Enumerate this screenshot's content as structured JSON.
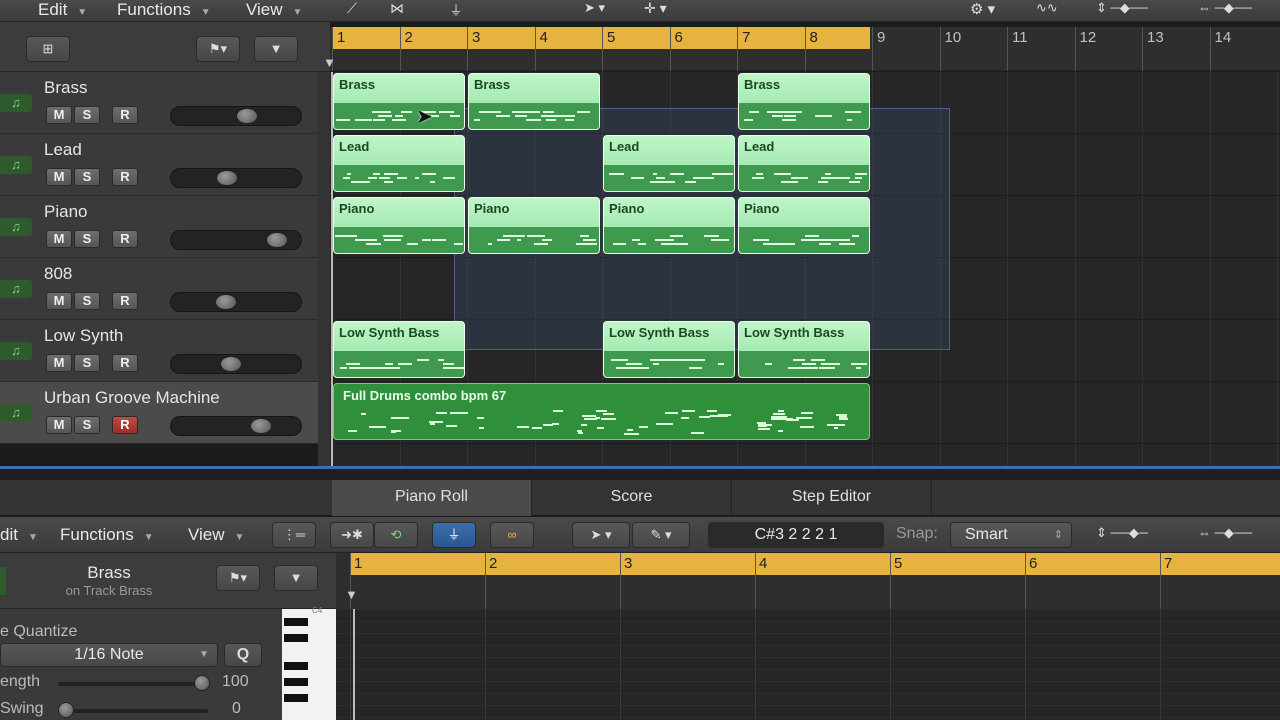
{
  "toolbar": {
    "edit": "Edit",
    "functions": "Functions",
    "view": "View"
  },
  "tracks": [
    {
      "name": "Brass",
      "m": "M",
      "s": "S",
      "r": "R",
      "volume": 0.6
    },
    {
      "name": "Lead",
      "m": "M",
      "s": "S",
      "r": "R",
      "volume": 0.42
    },
    {
      "name": "Piano",
      "m": "M",
      "s": "S",
      "r": "R",
      "volume": 0.88
    },
    {
      "name": "808",
      "m": "M",
      "s": "S",
      "r": "R",
      "volume": 0.41
    },
    {
      "name": "Low Synth",
      "m": "M",
      "s": "S",
      "r": "R",
      "volume": 0.45
    },
    {
      "name": "Urban Groove Machine",
      "m": "M",
      "s": "S",
      "r": "R",
      "volume": 0.73,
      "record_armed": true
    }
  ],
  "ruler": {
    "bars": [
      "1",
      "2",
      "3",
      "4",
      "5",
      "6",
      "7",
      "8",
      "9",
      "10",
      "11",
      "12",
      "13",
      "14"
    ],
    "cycle_end_bar": 9
  },
  "regions": [
    {
      "name": "Brass",
      "track": 0,
      "start": 1,
      "length": 2
    },
    {
      "name": "Brass",
      "track": 0,
      "start": 3,
      "length": 2
    },
    {
      "name": "Brass",
      "track": 0,
      "start": 7,
      "length": 2
    },
    {
      "name": "Lead",
      "track": 1,
      "start": 1,
      "length": 2
    },
    {
      "name": "Lead",
      "track": 1,
      "start": 5,
      "length": 2
    },
    {
      "name": "Lead",
      "track": 1,
      "start": 7,
      "length": 2
    },
    {
      "name": "Piano",
      "track": 2,
      "start": 1,
      "length": 2
    },
    {
      "name": "Piano",
      "track": 2,
      "start": 3,
      "length": 2
    },
    {
      "name": "Piano",
      "track": 2,
      "start": 5,
      "length": 2
    },
    {
      "name": "Piano",
      "track": 2,
      "start": 7,
      "length": 2
    },
    {
      "name": "Low Synth Bass",
      "track": 4,
      "start": 1,
      "length": 2
    },
    {
      "name": "Low Synth Bass",
      "track": 4,
      "start": 5,
      "length": 2
    },
    {
      "name": "Low Synth Bass",
      "track": 4,
      "start": 7,
      "length": 2
    },
    {
      "name": "Full Drums combo bpm 67",
      "track": 5,
      "start": 1,
      "length": 8,
      "drums": true
    }
  ],
  "editor_tabs": [
    "Piano Roll",
    "Score",
    "Step Editor"
  ],
  "editor": {
    "edit": "dit",
    "functions": "Functions",
    "view": "View",
    "position": "C#3   2 2 2 1",
    "snap_label": "Snap:",
    "snap_value": "Smart",
    "region_name": "Brass",
    "region_track": "on Track Brass",
    "quantize_label": "e Quantize",
    "quantize_value": "1/16 Note",
    "q_button": "Q",
    "strength_label": "ength",
    "strength_value": "100",
    "swing_label": "Swing",
    "swing_value": "0",
    "bars": [
      "1",
      "2",
      "3",
      "4",
      "5",
      "6",
      "7"
    ],
    "key_label": "C4"
  },
  "colors": {
    "ruler_cycle": "#e6b340",
    "region_light": "#a9ecb6",
    "region_drums": "#2f8f3b",
    "accent_blue": "#3a6fb0"
  }
}
